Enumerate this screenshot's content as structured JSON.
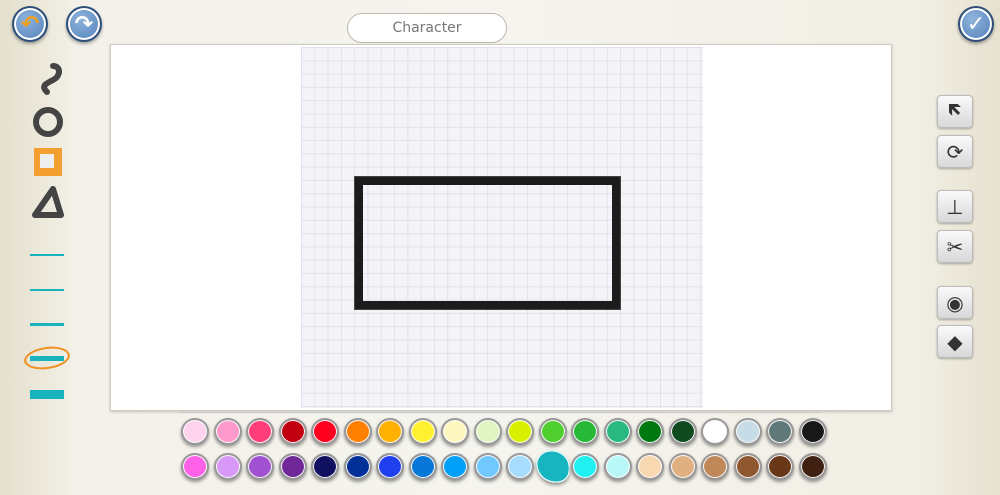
{
  "header": {
    "title": "Character",
    "undo_icon": "undo-icon",
    "redo_icon": "redo-icon",
    "confirm_icon": "checkmark-icon"
  },
  "left_tools": [
    "freehand-tool",
    "circle-tool",
    "rectangle-tool",
    "triangle-tool"
  ],
  "selected_tool": "rectangle-tool",
  "line_widths": [
    1,
    2,
    3,
    5,
    8
  ],
  "selected_line_width": 4,
  "right_tools": [
    "select-arrow",
    "rotate",
    "stamp",
    "scissors",
    "camera",
    "paint-bucket"
  ],
  "colors": {
    "row1": [
      "#ffd3ee",
      "#ff99cc",
      "#ff3d7a",
      "#c00010",
      "#ff0020",
      "#ff8000",
      "#ffb000",
      "#fff030",
      "#fff7c0",
      "#e0f5c0",
      "#d8f000",
      "#50d030",
      "#28b838",
      "#28b880",
      "#007810",
      "#104a20",
      "#ffffff",
      "#c8dce8",
      "#607878",
      "#181818"
    ],
    "row2": [
      "#ff60e8",
      "#d898f8",
      "#a050d0",
      "#702898",
      "#101060",
      "#003098",
      "#2040f0",
      "#0878d8",
      "#00a0f8",
      "#70c8ff",
      "#a8dcff",
      "#17b5c0",
      "#20f0f0",
      "#b8f8f8",
      "#f8d8b0",
      "#e0b080",
      "#c08858",
      "#905830",
      "#683818",
      "#402010"
    ],
    "selected": "#17b5c0"
  }
}
